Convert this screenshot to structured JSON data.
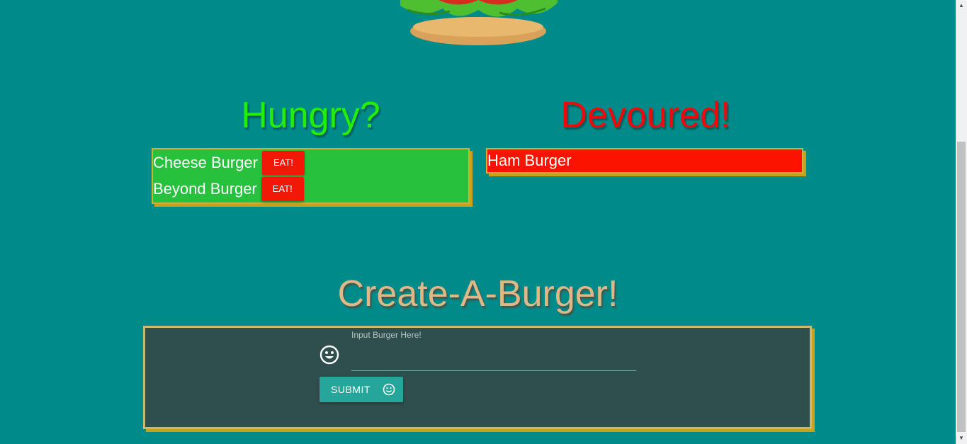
{
  "columns": {
    "hungry": {
      "title": "Hungry?",
      "items": [
        {
          "name": "Cheese Burger",
          "action": "EAT!"
        },
        {
          "name": "Beyond Burger",
          "action": "EAT!"
        }
      ]
    },
    "devoured": {
      "title": "Devoured!",
      "items": [
        {
          "name": "Ham Burger"
        }
      ]
    }
  },
  "create": {
    "title": "Create-A-Burger!",
    "input_label": "Input Burger Here!",
    "input_value": "",
    "submit_label": "SUBMIT"
  },
  "colors": {
    "background": "#008b8b",
    "hungry": "#22ee0a",
    "devoured": "#ee0a0a",
    "create": "#deb887",
    "submit": "#26a69a"
  },
  "icons": {
    "input_prefix": "smile-icon",
    "submit": "smile-icon"
  }
}
